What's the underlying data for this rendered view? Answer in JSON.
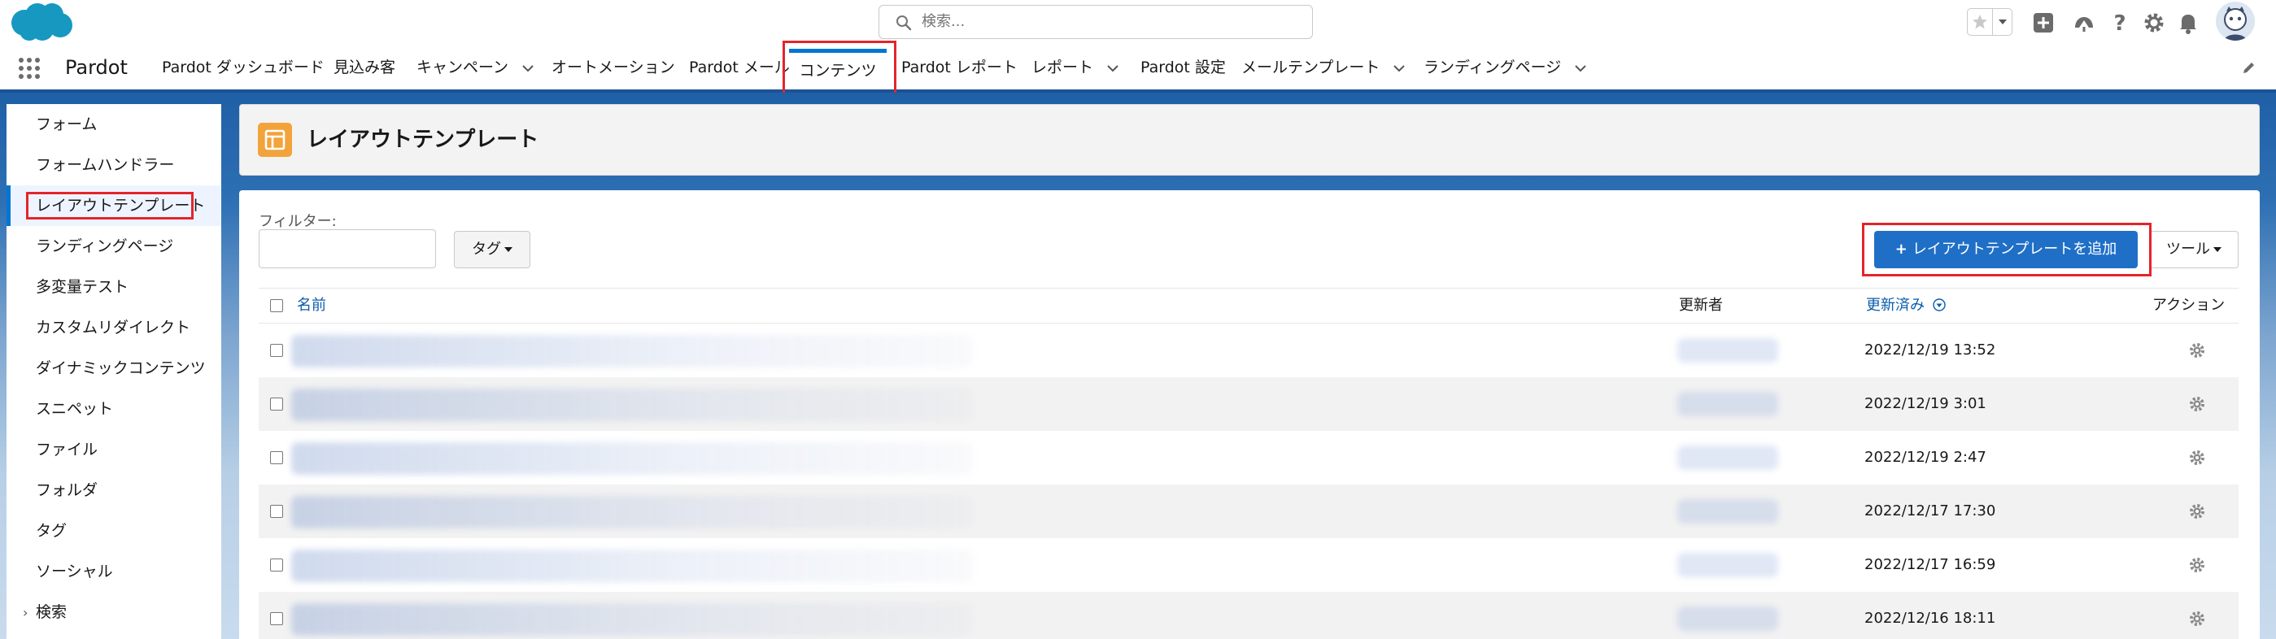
{
  "header": {
    "search_placeholder": "検索..."
  },
  "nav": {
    "app_name": "Pardot",
    "items": [
      {
        "label": "Pardot ダッシュボード",
        "chevron": false
      },
      {
        "label": "見込み客",
        "chevron": false
      },
      {
        "label": "キャンペーン",
        "chevron": true
      },
      {
        "label": "オートメーション",
        "chevron": false
      },
      {
        "label": "Pardot メール",
        "chevron": false
      },
      {
        "label": "コンテンツ",
        "chevron": false,
        "active": true
      },
      {
        "label": "Pardot レポート",
        "chevron": false
      },
      {
        "label": "レポート",
        "chevron": true
      },
      {
        "label": "Pardot 設定",
        "chevron": false
      },
      {
        "label": "メールテンプレート",
        "chevron": true
      },
      {
        "label": "ランディングページ",
        "chevron": true
      }
    ]
  },
  "sidebar": {
    "items": [
      {
        "label": "フォーム"
      },
      {
        "label": "フォームハンドラー"
      },
      {
        "label": "レイアウトテンプレート",
        "active": true
      },
      {
        "label": "ランディングページ"
      },
      {
        "label": "多変量テスト"
      },
      {
        "label": "カスタムリダイレクト"
      },
      {
        "label": "ダイナミックコンテンツ"
      },
      {
        "label": "スニペット"
      },
      {
        "label": "ファイル"
      },
      {
        "label": "フォルダ"
      },
      {
        "label": "タグ"
      },
      {
        "label": "ソーシャル"
      },
      {
        "label": "検索",
        "expandable": true
      }
    ]
  },
  "page": {
    "title": "レイアウトテンプレート"
  },
  "toolbar": {
    "filter_label": "フィルター:",
    "tag_label": "タグ",
    "add_label": "レイアウトテンプレートを追加",
    "tools_label": "ツール"
  },
  "table": {
    "columns": {
      "name": "名前",
      "updated_by": "更新者",
      "updated": "更新済み",
      "action": "アクション"
    },
    "rows": [
      {
        "date": "2022/12/19 13:52"
      },
      {
        "date": "2022/12/19 3:01"
      },
      {
        "date": "2022/12/19 2:47"
      },
      {
        "date": "2022/12/17 17:30"
      },
      {
        "date": "2022/12/17 16:59"
      },
      {
        "date": "2022/12/16 18:11"
      }
    ]
  },
  "colors": {
    "brand_blue": "#0176d3",
    "nav_bottom": "#1b5297",
    "primary_button": "#1f6fc7",
    "highlight_red": "#e3252b",
    "template_icon": "#f2a33a"
  }
}
